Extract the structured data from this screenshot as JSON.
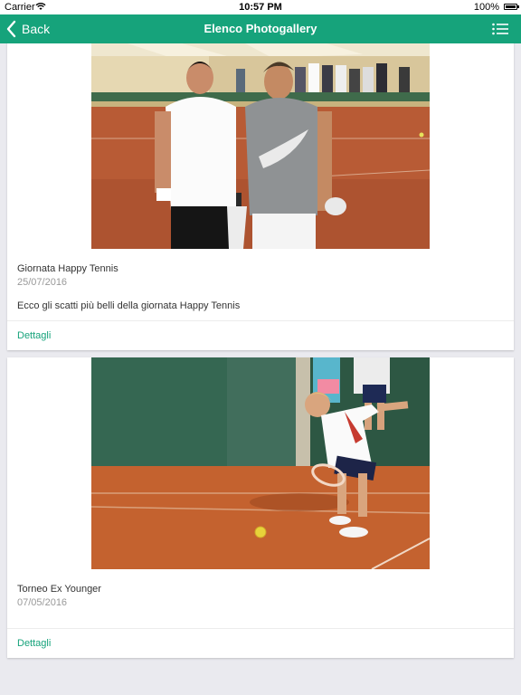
{
  "status_bar": {
    "carrier": "Carrier",
    "time": "10:57 PM",
    "battery": "100%"
  },
  "nav": {
    "back_label": "Back",
    "title": "Elenco Photogallery"
  },
  "colors": {
    "accent": "#16a37b",
    "background": "#eaeaef"
  },
  "galleries": [
    {
      "title": "Giornata Happy Tennis",
      "date": "25/07/2016",
      "description": "Ecco gli scatti più belli della giornata Happy Tennis",
      "details_label": "Dettagli"
    },
    {
      "title": "Torneo Ex Younger",
      "date": "07/05/2016",
      "details_label": "Dettagli"
    }
  ]
}
